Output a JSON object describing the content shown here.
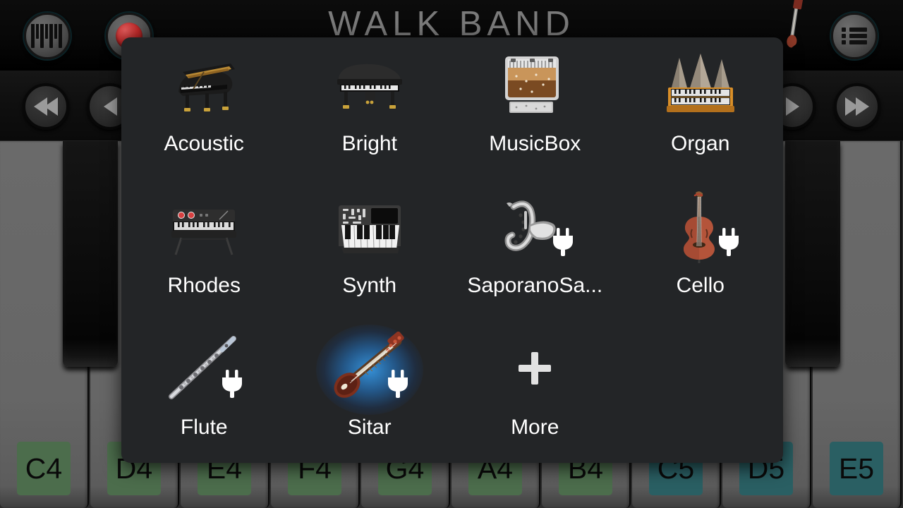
{
  "app": {
    "title": "WALK BAND"
  },
  "toolbar": {
    "keys_button": "piano-keys",
    "record_button": "record",
    "list_button": "song-list"
  },
  "transport": {
    "rewind": "rewind",
    "previous": "previous",
    "play": "play",
    "forward": "fast-forward"
  },
  "dialog": {
    "items": [
      {
        "label": "Acoustic",
        "icon": "grand-piano",
        "locked": false,
        "selected": false
      },
      {
        "label": "Bright",
        "icon": "bright-piano",
        "locked": false,
        "selected": false
      },
      {
        "label": "MusicBox",
        "icon": "music-box",
        "locked": false,
        "selected": false
      },
      {
        "label": "Organ",
        "icon": "pipe-organ",
        "locked": false,
        "selected": false
      },
      {
        "label": "Rhodes",
        "icon": "rhodes-piano",
        "locked": false,
        "selected": false
      },
      {
        "label": "Synth",
        "icon": "synthesizer",
        "locked": false,
        "selected": false
      },
      {
        "label": "SaporanoSa...",
        "icon": "saxophone",
        "locked": true,
        "selected": false
      },
      {
        "label": "Cello",
        "icon": "cello",
        "locked": true,
        "selected": false
      },
      {
        "label": "Flute",
        "icon": "flute",
        "locked": true,
        "selected": false
      },
      {
        "label": "Sitar",
        "icon": "sitar",
        "locked": true,
        "selected": true
      },
      {
        "label": "More",
        "icon": "plus",
        "locked": false,
        "selected": false
      }
    ]
  },
  "piano": {
    "white_keys": [
      {
        "note": "C4",
        "color": "#4c6d4c"
      },
      {
        "note": "D4",
        "color": "#4c6d4c"
      },
      {
        "note": "E4",
        "color": "#4c6d4c"
      },
      {
        "note": "F4",
        "color": "#4c6d4c"
      },
      {
        "note": "G4",
        "color": "#4c6d4c"
      },
      {
        "note": "A4",
        "color": "#4c6d4c"
      },
      {
        "note": "B4",
        "color": "#4c6d4c"
      },
      {
        "note": "C5",
        "color": "#2a5f63"
      },
      {
        "note": "D5",
        "color": "#2a5f63"
      },
      {
        "note": "E5",
        "color": "#2a5f63"
      }
    ],
    "black_key_slots": [
      0,
      1,
      3,
      4,
      5,
      7,
      8
    ]
  },
  "colors": {
    "dialog_bg": "#232527",
    "octave4_badge": "#4c6d4c",
    "octave5_badge": "#2a5f63",
    "selection_glow": "#3696e1",
    "record_red": "#c02a2a"
  }
}
